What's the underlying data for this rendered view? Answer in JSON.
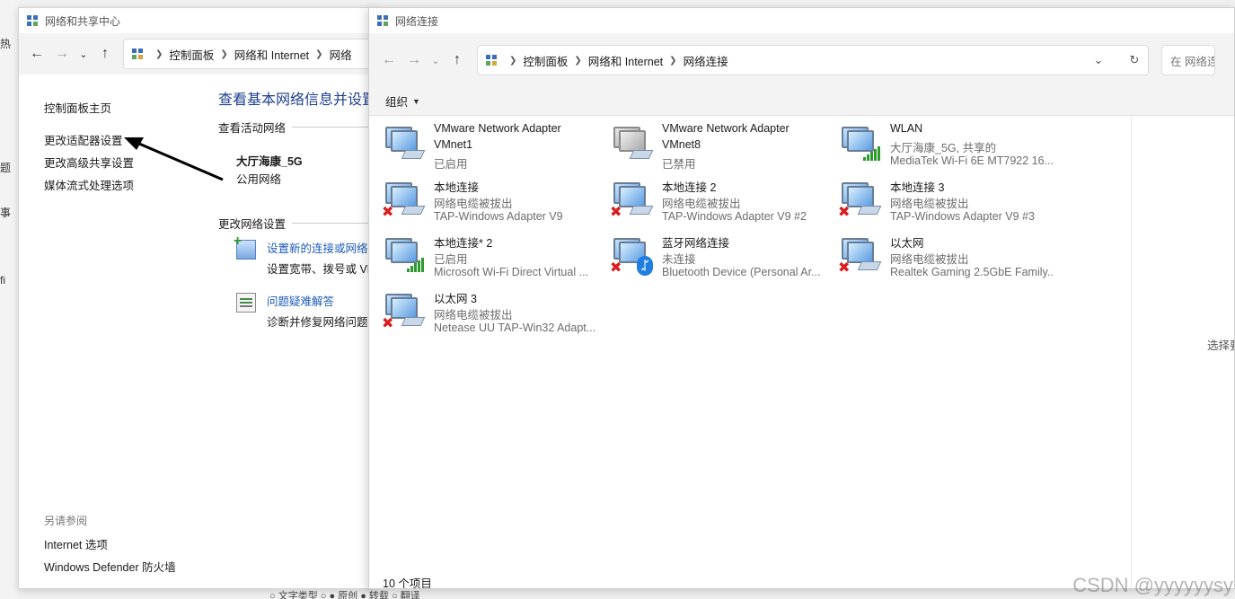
{
  "desktop": {
    "edge_chars": [
      "热",
      "题",
      "事",
      "fi"
    ],
    "bottom_text": "○ 文字类型 ○ ● 原创 ● 转载 ○ 翻译"
  },
  "window1": {
    "title": "网络和共享中心",
    "breadcrumbs": [
      "控制面板",
      "网络和 Internet",
      "网络"
    ],
    "left_links": [
      "控制面板主页",
      "更改适配器设置",
      "更改高级共享设置",
      "媒体流式处理选项"
    ],
    "see_also_label": "另请参阅",
    "see_also_links": [
      "Internet 选项",
      "Windows Defender 防火墙"
    ],
    "heading": "查看基本网络信息并设置",
    "active_networks_label": "查看活动网络",
    "network_name": "大厅海康_5G",
    "network_type": "公用网络",
    "change_settings_label": "更改网络设置",
    "tasks": [
      {
        "icon": "network-setup-icon",
        "link": "设置新的连接或网络",
        "desc": "设置宽带、拨号或 VP"
      },
      {
        "icon": "troubleshoot-icon",
        "link": "问题疑难解答",
        "desc": "诊断并修复网络问题,"
      }
    ]
  },
  "window2": {
    "title": "网络连接",
    "breadcrumbs": [
      "控制面板",
      "网络和 Internet",
      "网络连接"
    ],
    "search_placeholder": "在 网络连",
    "organize_label": "组织",
    "item_count": "10 个项目",
    "details_hint": "选择要",
    "adapters": [
      {
        "name": "VMware Network Adapter",
        "name2": "VMnet1",
        "status": "已启用",
        "device": "",
        "state": "enabled"
      },
      {
        "name": "VMware Network Adapter",
        "name2": "VMnet8",
        "status": "已禁用",
        "device": "",
        "state": "disabled"
      },
      {
        "name": "WLAN",
        "name2": "",
        "status": "大厅海康_5G, 共享的",
        "device": "MediaTek Wi-Fi 6E MT7922 16...",
        "state": "wifi"
      },
      {
        "name": "本地连接",
        "name2": "",
        "status": "网络电缆被拔出",
        "device": "TAP-Windows Adapter V9",
        "state": "unplugged"
      },
      {
        "name": "本地连接 2",
        "name2": "",
        "status": "网络电缆被拔出",
        "device": "TAP-Windows Adapter V9 #2",
        "state": "unplugged"
      },
      {
        "name": "本地连接 3",
        "name2": "",
        "status": "网络电缆被拔出",
        "device": "TAP-Windows Adapter V9 #3",
        "state": "unplugged"
      },
      {
        "name": "本地连接* 2",
        "name2": "",
        "status": "已启用",
        "device": "Microsoft Wi-Fi Direct Virtual ...",
        "state": "wifi"
      },
      {
        "name": "蓝牙网络连接",
        "name2": "",
        "status": "未连接",
        "device": "Bluetooth Device (Personal Ar...",
        "state": "bluetooth"
      },
      {
        "name": "以太网",
        "name2": "",
        "status": "网络电缆被拔出",
        "device": "Realtek Gaming 2.5GbE Family...",
        "state": "unplugged"
      },
      {
        "name": "以太网 3",
        "name2": "",
        "status": "网络电缆被拔出",
        "device": "Netease UU TAP-Win32 Adapt...",
        "state": "unplugged"
      }
    ]
  },
  "watermark": "CSDN @yyyyyysy",
  "colors": {
    "link_blue": "#1e5bb8",
    "heading_blue": "#1e3f8f",
    "error_red": "#d81e1e",
    "signal_green": "#2e9a2e",
    "bluetooth_blue": "#1f7ee0"
  }
}
